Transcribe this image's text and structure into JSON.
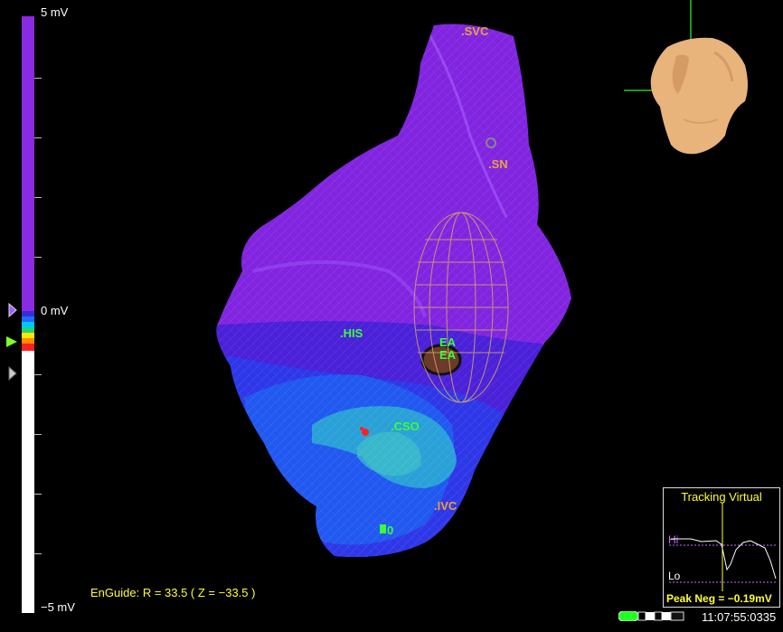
{
  "scale": {
    "max_label": "5 mV",
    "zero_label": "0 mV",
    "min_label": "−5 mV",
    "colors": {
      "upper": "#8a2be2",
      "lower": "#ffffff",
      "bands": [
        "#3b2dd6",
        "#1e6bff",
        "#00c8ff",
        "#26d27a",
        "#ffe800",
        "#ff8c00",
        "#ff1e1e"
      ]
    }
  },
  "labels": {
    "svc": ".SVC",
    "sn": ".SN",
    "his": ".HIS",
    "ea1": "EA",
    "ea2": "EA",
    "cso": ".CSO",
    "ivc": ".IVC",
    "marker": "0"
  },
  "tracking": {
    "title": "Tracking Virtual",
    "hi": "Hi",
    "lo": "Lo",
    "peak": "Peak Neg = −0.19mV"
  },
  "status": {
    "enguide": "EnGuide: R = 33.5  ( Z = −33.5 )",
    "time": "11:07:55:0335"
  }
}
